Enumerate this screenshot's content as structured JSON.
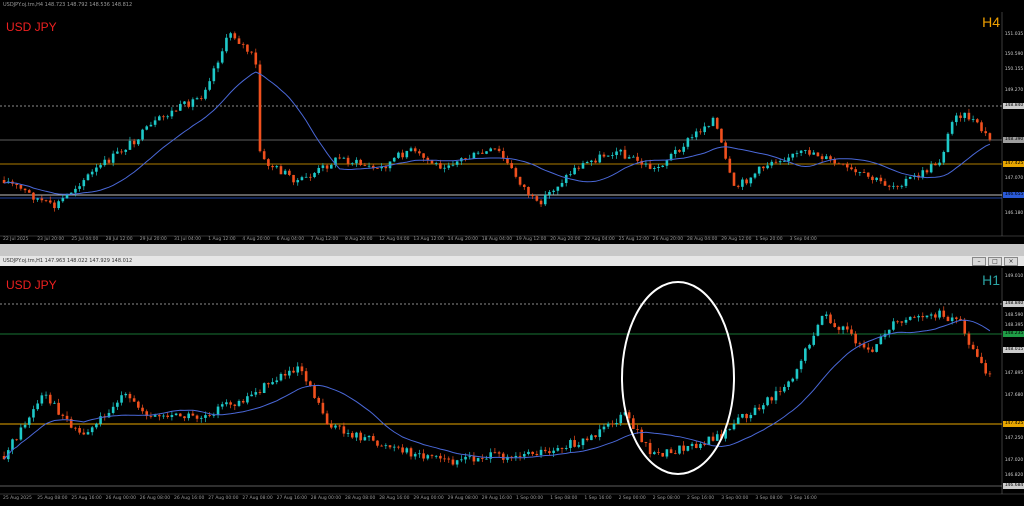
{
  "colors": {
    "bull": "#1ec8c8",
    "bear": "#f0501e",
    "ma": "#4a68d8",
    "hline_gold": "#e8a600",
    "hline_blue": "#2a5ad8",
    "hline_green": "#1f9d46",
    "grid_dotted": "#bbbbbb",
    "symbol_label": "#ee2020",
    "tf_h4": "#f0a000",
    "tf_h1": "#2aa2a2"
  },
  "top": {
    "title": "USDJPY.oj.tm,H4  148.723 148.792 148.536 148.812",
    "symbol": "USD JPY",
    "timeframe": "H4",
    "price_labels": [
      "151.035",
      "150.590",
      "150.155",
      "149.270",
      "148.840",
      "148.390",
      "147.425",
      "147.070",
      "146.655",
      "146.180"
    ],
    "x_labels": [
      "22 Jul 2025",
      "23 Jul 20:00",
      "25 Jul 04:00",
      "28 Jul 12:00",
      "29 Jul 20:00",
      "31 Jul 04:00",
      "1 Aug 12:00",
      "4 Aug 20:00",
      "6 Aug 04:00",
      "7 Aug 12:00",
      "8 Aug 20:00",
      "12 Aug 04:00",
      "13 Aug 12:00",
      "14 Aug 20:00",
      "18 Aug 04:00",
      "19 Aug 12:00",
      "20 Aug 20:00",
      "22 Aug 04:00",
      "25 Aug 12:00",
      "26 Aug 20:00",
      "28 Aug 04:00",
      "29 Aug 12:00",
      "1 Sep 20:00",
      "3 Sep 04:00"
    ]
  },
  "bottom": {
    "title": "USDJPY.oj.tm,H1  147.963 148.022 147.929 148.012",
    "symbol": "USD JPY",
    "timeframe": "H1",
    "price_labels": [
      "149.010",
      "148.840",
      "148.590",
      "148.395",
      "148.235",
      "148.015",
      "147.895",
      "147.680",
      "147.425",
      "147.250",
      "147.020",
      "146.820",
      "146.684"
    ],
    "x_labels": [
      "25 Aug 2025",
      "25 Aug 08:00",
      "25 Aug 16:00",
      "26 Aug 00:00",
      "26 Aug 08:00",
      "26 Aug 16:00",
      "27 Aug 00:00",
      "27 Aug 08:00",
      "27 Aug 16:00",
      "28 Aug 00:00",
      "28 Aug 08:00",
      "28 Aug 16:00",
      "29 Aug 00:00",
      "29 Aug 08:00",
      "29 Aug 16:00",
      "1 Sep 00:00",
      "1 Sep 08:00",
      "1 Sep 16:00",
      "2 Sep 00:00",
      "2 Sep 08:00",
      "2 Sep 16:00",
      "3 Sep 00:00",
      "3 Sep 08:00",
      "3 Sep 16:00"
    ]
  }
}
